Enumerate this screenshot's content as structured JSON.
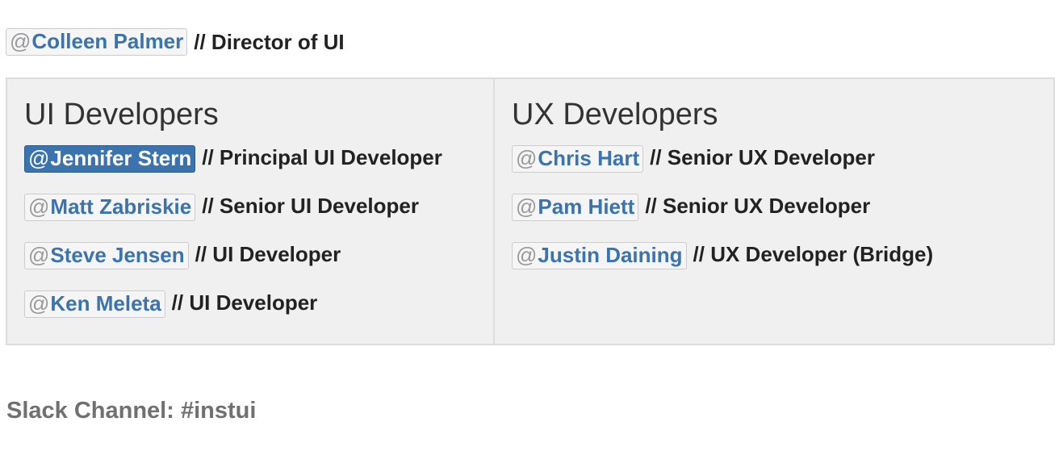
{
  "director": {
    "at": "@",
    "name": "Colleen Palmer",
    "role": "// Director of UI"
  },
  "ui_team": {
    "title": "UI Developers",
    "members": [
      {
        "at": "@",
        "name": "Jennifer Stern",
        "role": "// Principal UI Developer",
        "selected": true
      },
      {
        "at": "@",
        "name": "Matt Zabriskie",
        "role": "// Senior UI Developer"
      },
      {
        "at": "@",
        "name": "Steve Jensen",
        "role": "// UI Developer"
      },
      {
        "at": "@",
        "name": "Ken Meleta",
        "role": "// UI Developer"
      }
    ]
  },
  "ux_team": {
    "title": "UX Developers",
    "members": [
      {
        "at": "@",
        "name": "Chris Hart",
        "role": "// Senior UX Developer"
      },
      {
        "at": "@",
        "name": "Pam Hiett",
        "role": "// Senior UX Developer"
      },
      {
        "at": "@",
        "name": "Justin Daining",
        "role": "// UX Developer (Bridge)"
      }
    ]
  },
  "slack": {
    "text": "Slack Channel: #instui"
  },
  "colors": {
    "mention_text": "#3b73af",
    "mention_selected_bg": "#3b73af",
    "panel_bg": "#f0f0f0"
  }
}
